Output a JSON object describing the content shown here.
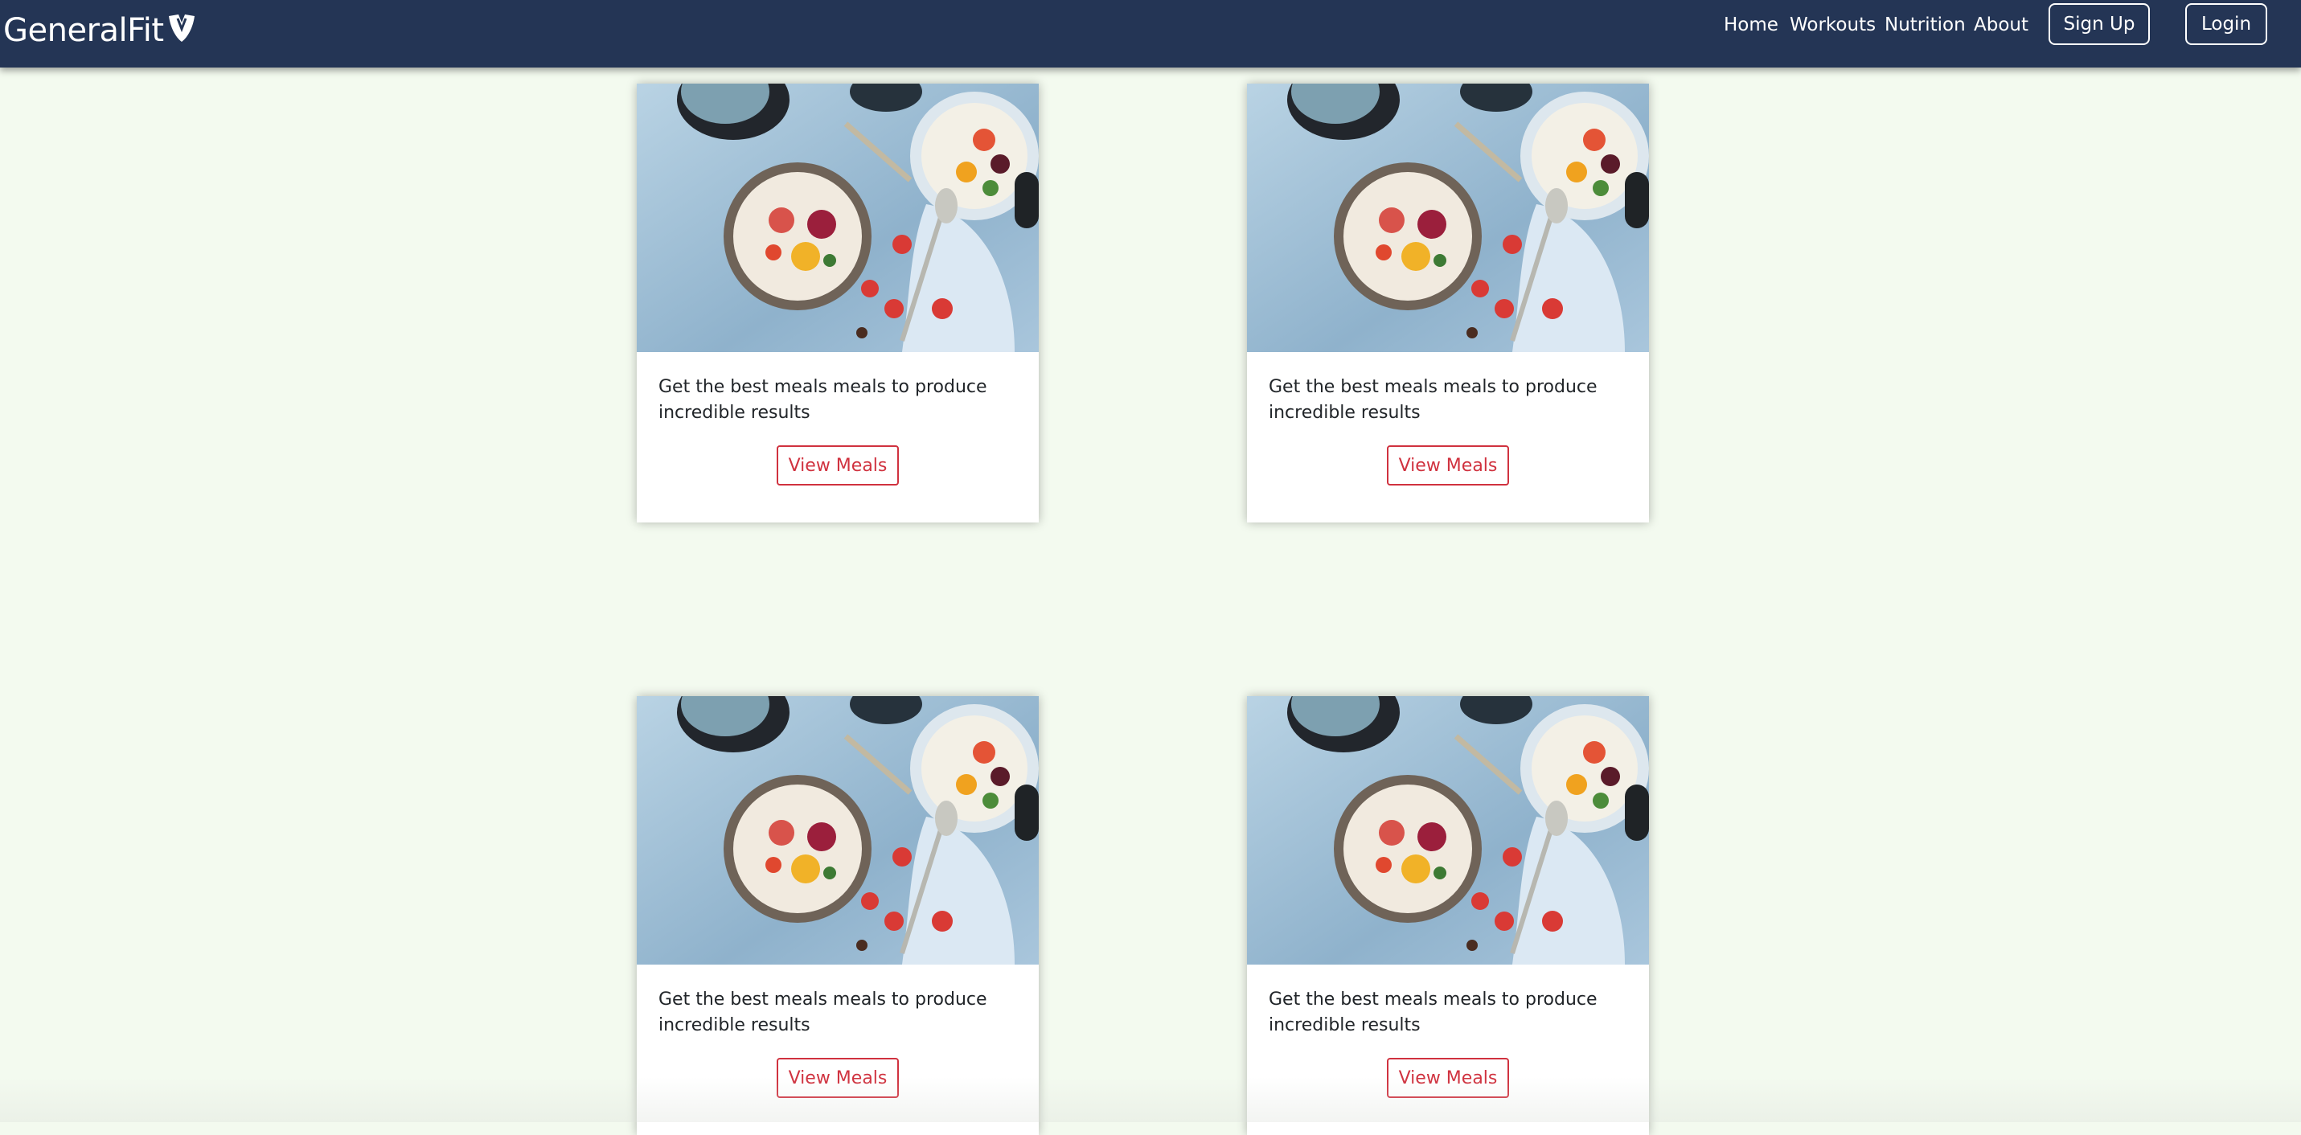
{
  "header": {
    "brand": "GeneralFit",
    "nav": [
      "Home",
      "Workouts",
      "Nutrition",
      "About"
    ],
    "signup_label": "Sign Up",
    "login_label": "Login"
  },
  "cards": [
    {
      "text": "Get the best meals meals to produce incredible results",
      "button": "View Meals"
    },
    {
      "text": "Get the best meals meals to produce incredible results",
      "button": "View Meals"
    },
    {
      "text": "Get the best meals meals to produce incredible results",
      "button": "View Meals"
    },
    {
      "text": "Get the best meals meals to produce incredible results",
      "button": "View Meals"
    }
  ],
  "colors": {
    "navbar": "#243555",
    "background": "#f3faef",
    "accent": "#d0323f"
  }
}
